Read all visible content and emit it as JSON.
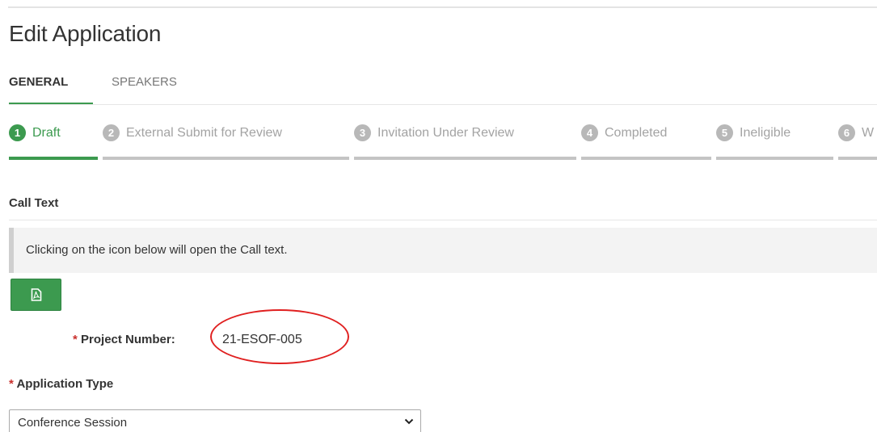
{
  "page": {
    "title": "Edit Application"
  },
  "tabs": [
    {
      "label": "GENERAL",
      "active": true
    },
    {
      "label": "SPEAKERS",
      "active": false
    }
  ],
  "steps": [
    {
      "num": "1",
      "label": "Draft",
      "active": true
    },
    {
      "num": "2",
      "label": "External Submit for Review",
      "active": false
    },
    {
      "num": "3",
      "label": "Invitation Under Review",
      "active": false
    },
    {
      "num": "4",
      "label": "Completed",
      "active": false
    },
    {
      "num": "5",
      "label": "Ineligible",
      "active": false
    },
    {
      "num": "6",
      "label": "W",
      "active": false
    }
  ],
  "call_text": {
    "section_title": "Call Text",
    "info": "Clicking on the icon below will open the Call text.",
    "pdf_icon": "pdf-file-icon"
  },
  "project_number": {
    "required_mark": "*",
    "label": "Project Number:",
    "value": "21-ESOF-005"
  },
  "application_type": {
    "required_mark": "*",
    "label": "Application Type",
    "selected": "Conference Session"
  },
  "colors": {
    "accent_green": "#3c9a4f",
    "inactive_step": "#b8b8b8",
    "required_red": "#c9302c",
    "annotation_red": "#e02020"
  }
}
